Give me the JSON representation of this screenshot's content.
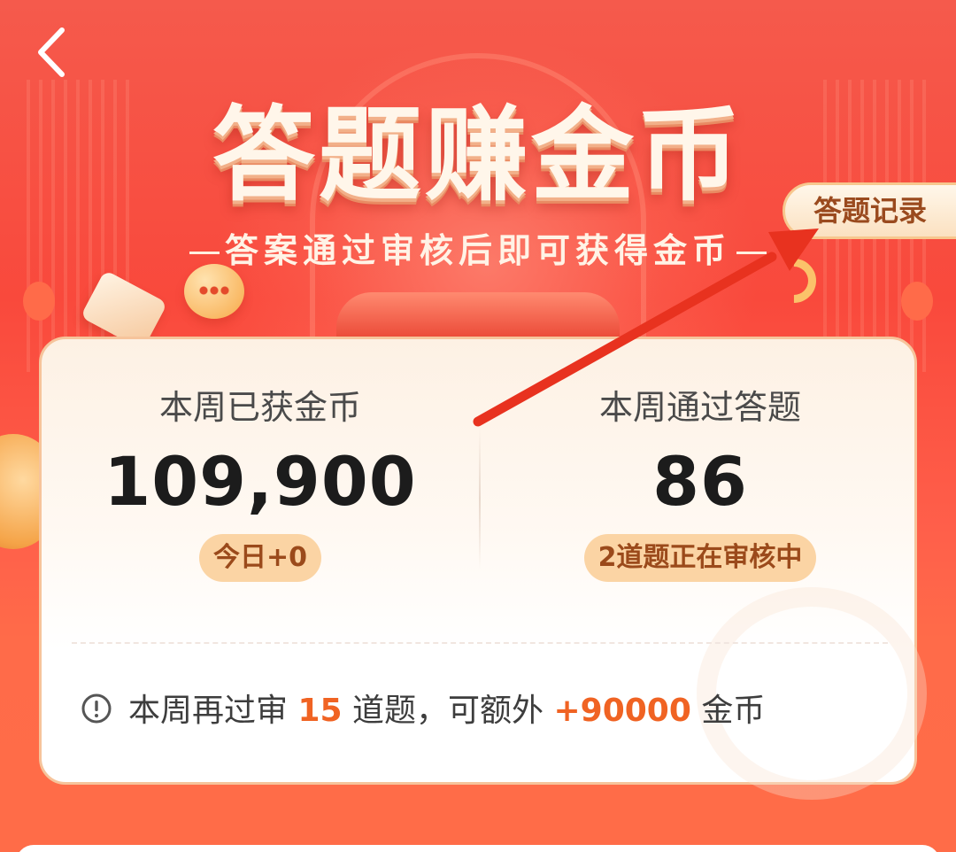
{
  "header": {
    "back_icon": "chevron-left-icon",
    "title": "答题赚金币",
    "subtitle": "答案通过审核后即可获得金币",
    "records_button": "答题记录"
  },
  "stats": {
    "coins_label": "本周已获金币",
    "coins_value": "109,900",
    "coins_today": "今日+0",
    "answers_label": "本周通过答题",
    "answers_value": "86",
    "answers_pending": "2道题正在审核中"
  },
  "bonus": {
    "info_icon": "info-circle-icon",
    "prefix": "本周再过审",
    "count": "15",
    "middle": "道题，可额外",
    "reward": "+90000",
    "suffix": "金币"
  },
  "colors": {
    "accent": "#f06323",
    "banner_red": "#f9493c",
    "badge_bg": "#fbd4a4",
    "annotation_arrow": "#e8321f"
  }
}
